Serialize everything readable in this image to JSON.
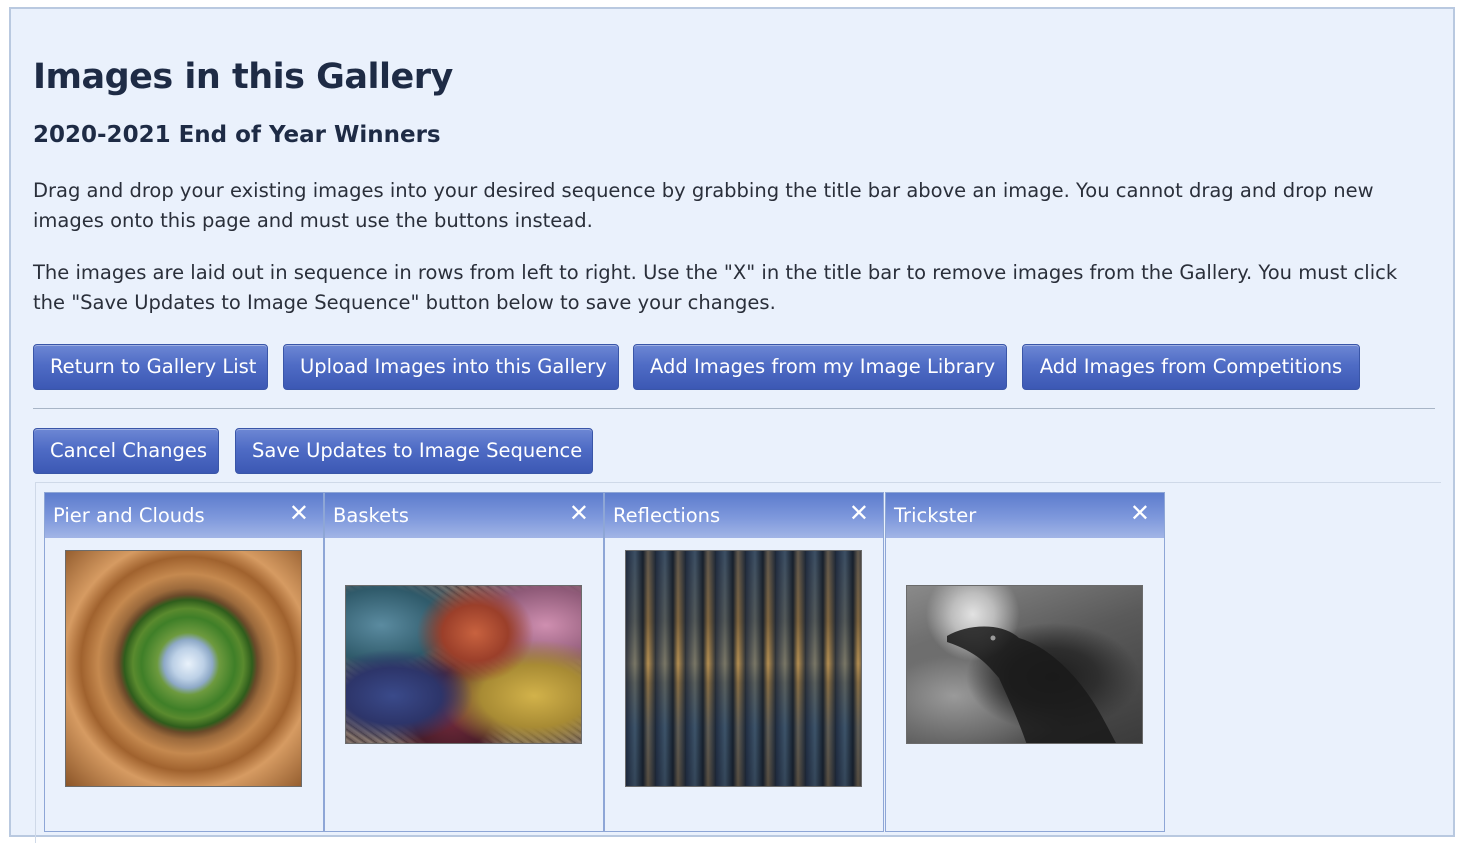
{
  "page": {
    "title": "Images in this Gallery",
    "subtitle": "2020-2021 End of Year Winners",
    "paragraphs": [
      "Drag and drop your existing images into your desired sequence by grabbing the title bar above an image. You cannot drag and drop new images onto this page and must use the buttons instead.",
      "The images are laid out in sequence in rows from left to right. Use the \"X\" in the title bar to remove images from the Gallery. You must click the \"Save Updates to Image Sequence\" button below to save your changes."
    ]
  },
  "actions": {
    "return": "Return to Gallery List",
    "upload": "Upload Images into this Gallery",
    "library": "Add Images from my Image Library",
    "competitions": "Add Images from Competitions",
    "cancel": "Cancel Changes",
    "save": "Save Updates to Image Sequence"
  },
  "gallery": {
    "images": [
      {
        "title": "Pier and Clouds",
        "close": "✕"
      },
      {
        "title": "Baskets",
        "close": "✕"
      },
      {
        "title": "Reflections",
        "close": "✕"
      },
      {
        "title": "Trickster",
        "close": "✕"
      }
    ]
  },
  "colors": {
    "panel_bg": "#eaf1fc",
    "button_accent": "#4f6cc5",
    "heading": "#1e2b45"
  }
}
